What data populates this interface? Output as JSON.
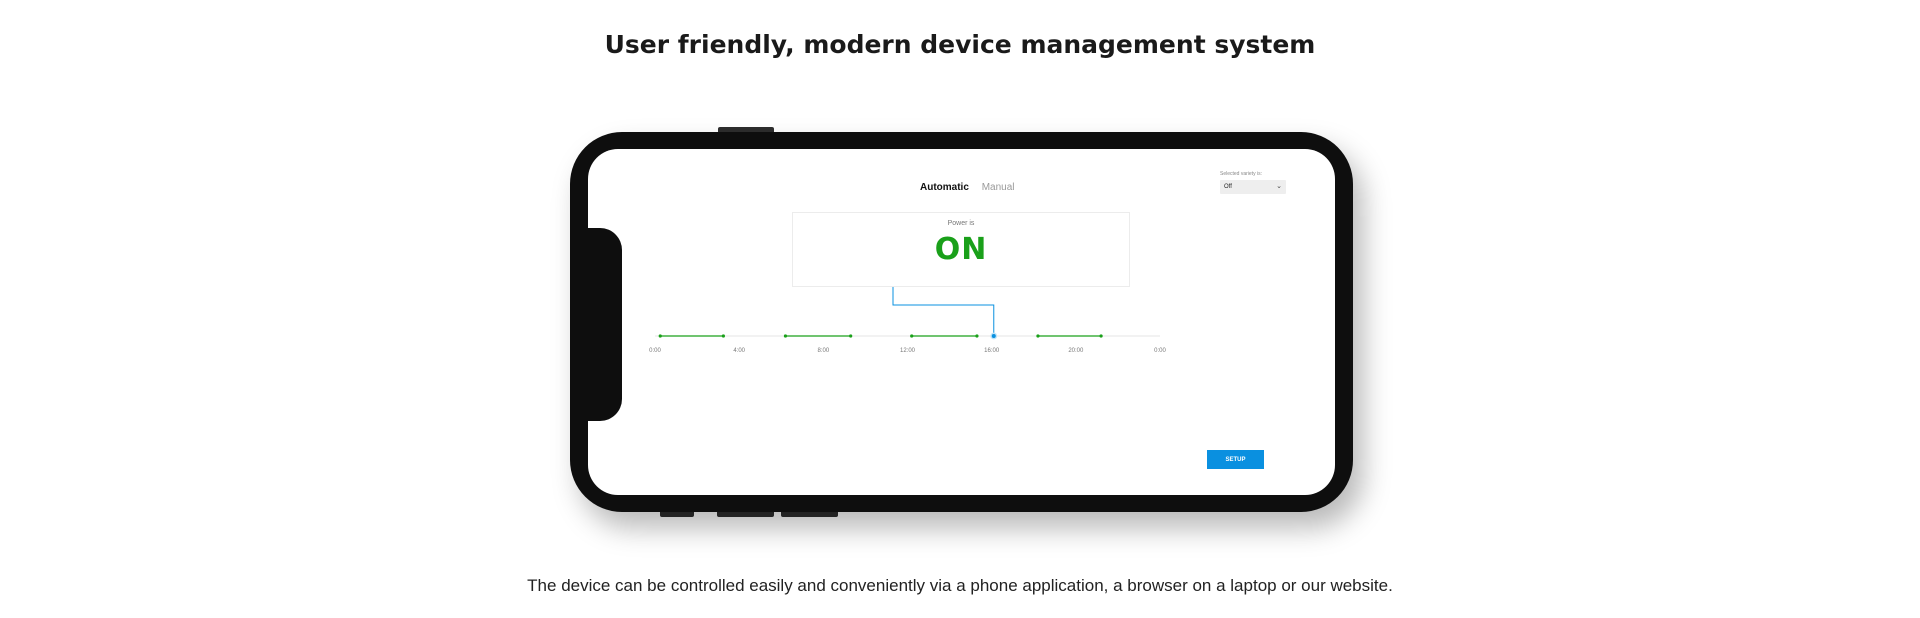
{
  "headline": "User friendly, modern device management system",
  "caption": "The device can be controlled easily and conveniently via a phone application, a browser on a laptop or our website.",
  "app": {
    "tabs": [
      {
        "label": "Automatic",
        "active": true
      },
      {
        "label": "Manual",
        "active": false
      }
    ],
    "device_select": {
      "label": "Selected variety is:",
      "value": "Off"
    },
    "power": {
      "label": "Power is",
      "state": "ON"
    },
    "timeline": {
      "ticks": [
        "0:00",
        "4:00",
        "8:00",
        "12:00",
        "16:00",
        "20:00",
        "0:00"
      ],
      "on_segments": [
        [
          0.25,
          3.25
        ],
        [
          6.2,
          9.3
        ],
        [
          12.2,
          15.3
        ],
        [
          18.2,
          21.2
        ]
      ],
      "current_hour": 16.1
    },
    "setup_button": "SETUP"
  },
  "colors": {
    "on_green": "#1aa01a",
    "accent_blue": "#0a90e0",
    "phone_body": "#0e0e0e"
  }
}
